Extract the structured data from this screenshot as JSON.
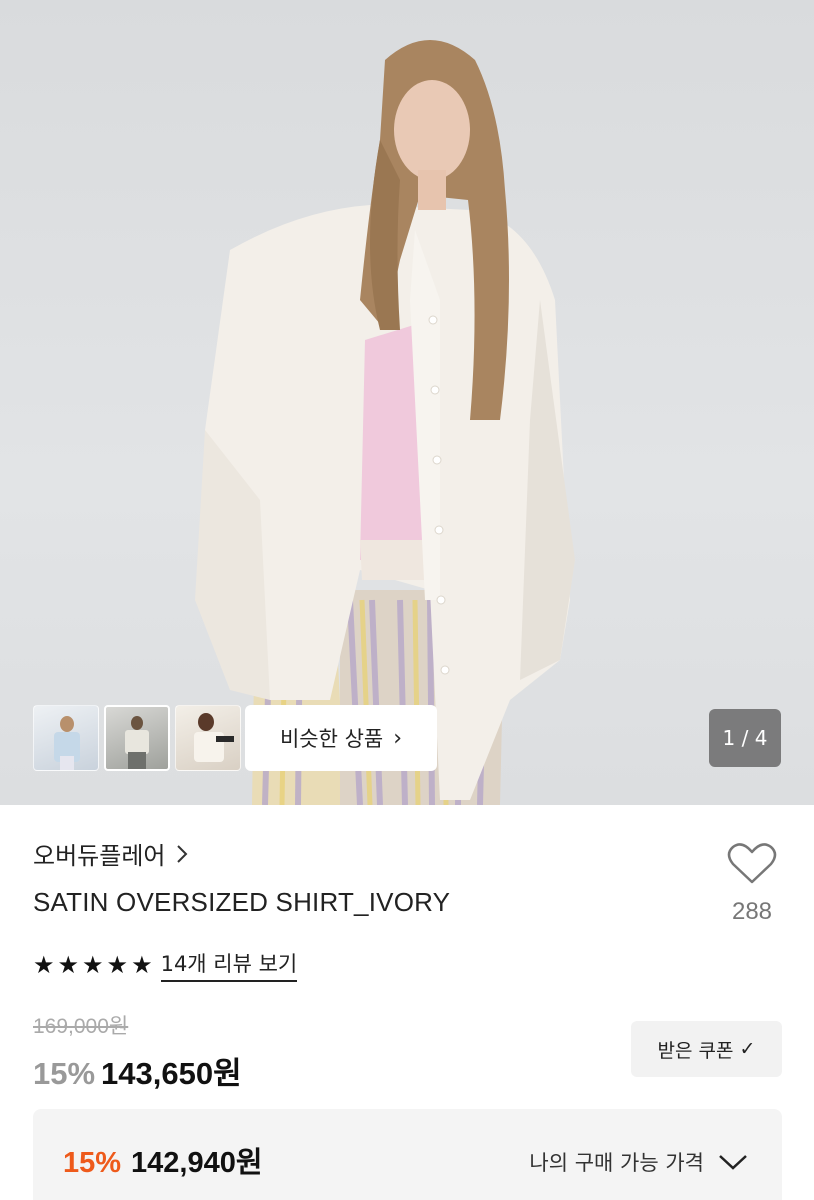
{
  "gallery": {
    "similar_label": "비슷한 상품",
    "chevron_right": "›",
    "counter": "1 / 4",
    "thumbnails": [
      "thumbnail-1",
      "thumbnail-2",
      "thumbnail-3"
    ]
  },
  "product": {
    "brand": "오버듀플레어",
    "name": "SATIN OVERSIZED SHIRT_IVORY",
    "like_count": "288",
    "rating_stars": 5,
    "review_link": "14개 리뷰 보기",
    "original_price": "169,000원",
    "discount_rate": "15%",
    "price": "143,650원",
    "coupon_label": "받은 쿠폰",
    "coupon_check": "✓"
  },
  "best_price": {
    "discount_rate": "15%",
    "price": "142,940원",
    "label": "나의 구매 가능 가격"
  },
  "colors": {
    "accent_orange": "#ee5a1b",
    "background": "#ffffff",
    "panel_gray": "#f4f4f4"
  }
}
